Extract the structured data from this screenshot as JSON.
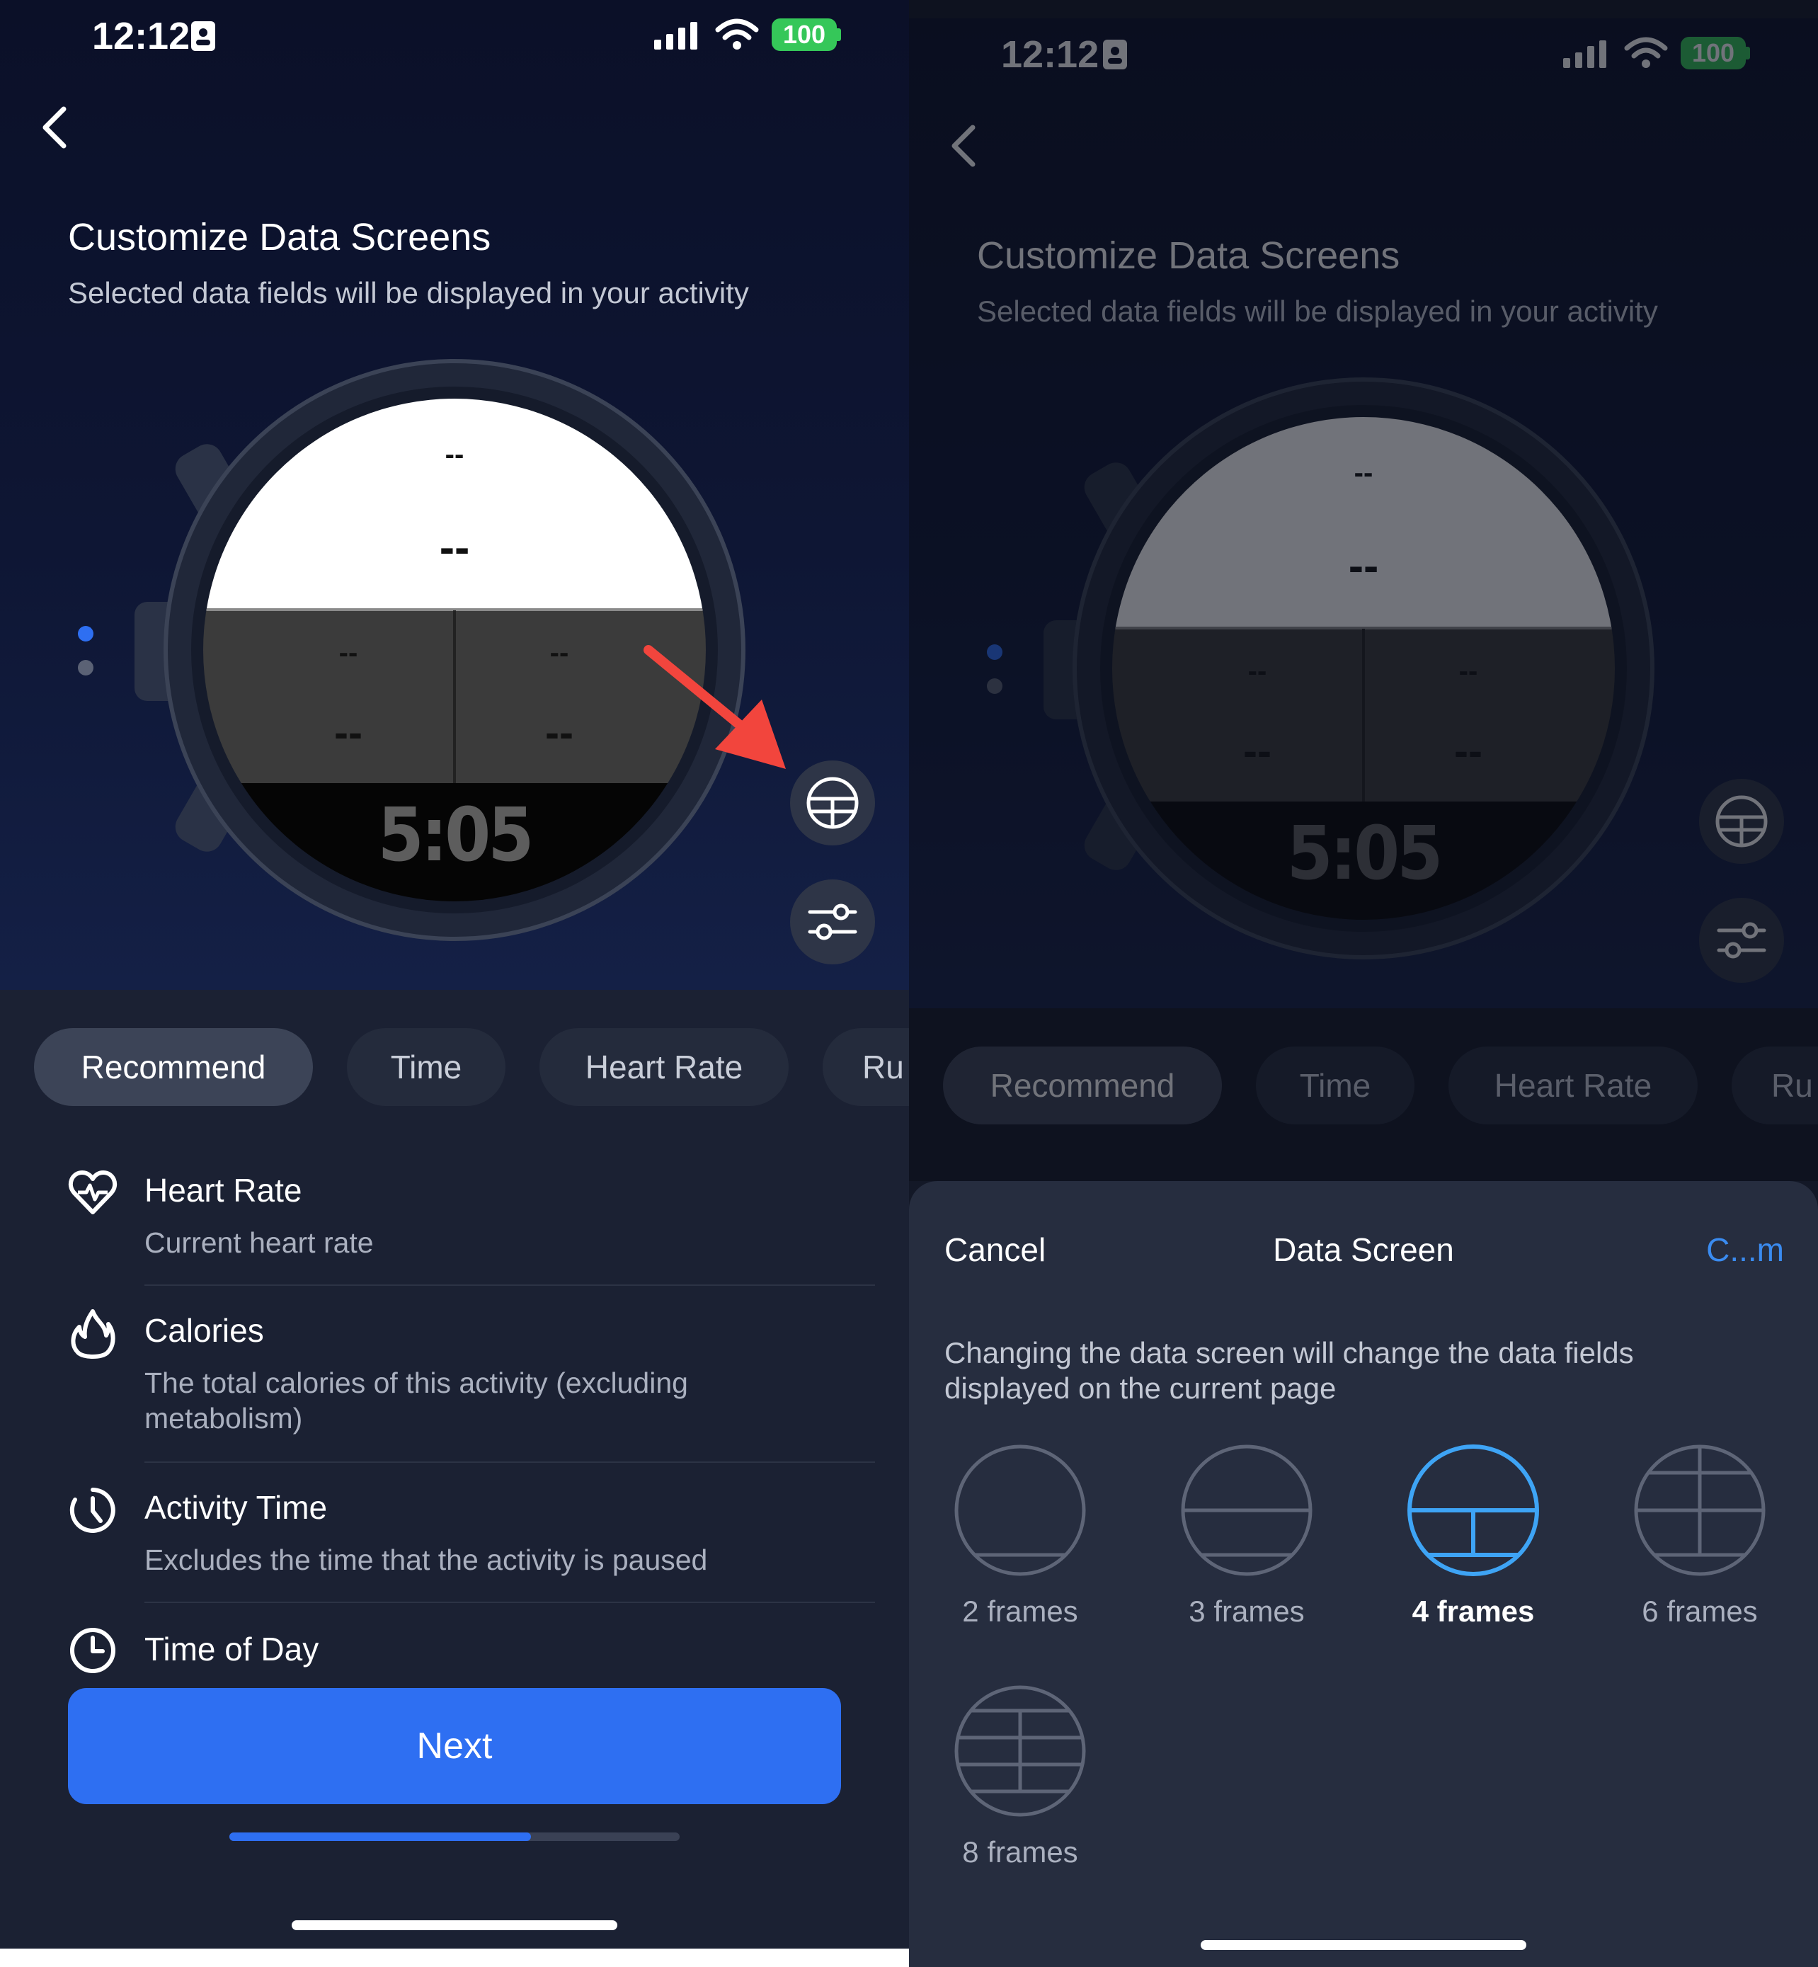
{
  "status": {
    "time": "12:12",
    "battery": "100"
  },
  "header": {
    "title": "Customize Data Screens",
    "subtitle": "Selected data fields will be displayed in your activity"
  },
  "watch": {
    "placeholder_small": "--",
    "placeholder_large": "--",
    "clock": "5:05"
  },
  "tabs": [
    {
      "label": "Recommend",
      "active": true
    },
    {
      "label": "Time",
      "active": false
    },
    {
      "label": "Heart Rate",
      "active": false
    },
    {
      "label": "Ru",
      "active": false
    }
  ],
  "fields": [
    {
      "icon": "heart-rate-icon",
      "title": "Heart Rate",
      "desc": "Current heart rate"
    },
    {
      "icon": "flame-icon",
      "title": "Calories",
      "desc": "The total calories of this activity (excluding metabolism)"
    },
    {
      "icon": "stopwatch-icon",
      "title": "Activity Time",
      "desc": "Excludes the time that the activity is paused"
    },
    {
      "icon": "clock-icon",
      "title": "Time of Day",
      "desc": ""
    }
  ],
  "next_label": "Next",
  "progress": 0.67,
  "sheet": {
    "cancel": "Cancel",
    "title": "Data Screen",
    "confirm": "C...m",
    "message": "Changing the data screen will change the data fields displayed on the current page",
    "options": [
      {
        "label": "2 frames",
        "selected": false
      },
      {
        "label": "3 frames",
        "selected": false
      },
      {
        "label": "4 frames",
        "selected": true
      },
      {
        "label": "6 frames",
        "selected": false
      },
      {
        "label": "8 frames",
        "selected": false
      }
    ]
  },
  "colors": {
    "accent": "#2e6ff2",
    "selected_frame": "#3ea4f5",
    "battery": "#35c759",
    "annotation_arrow": "#f2453d"
  }
}
